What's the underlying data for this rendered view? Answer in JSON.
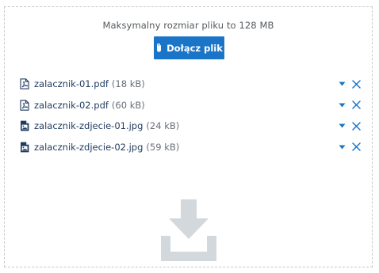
{
  "uploader": {
    "max_size_text": "Maksymalny rozmiar pliku to 128 MB",
    "attach_button_label": "Dołącz plik",
    "drop_icon": "download-tray-icon"
  },
  "files": [
    {
      "name": "zalacznik-01.pdf",
      "size": "(18 kB)",
      "type": "pdf"
    },
    {
      "name": "zalacznik-02.pdf",
      "size": "(60 kB)",
      "type": "pdf"
    },
    {
      "name": "zalacznik-zdjecie-01.jpg",
      "size": "(24 kB)",
      "type": "image"
    },
    {
      "name": "zalacznik-zdjecie-02.jpg",
      "size": "(59 kB)",
      "type": "image"
    }
  ],
  "colors": {
    "accent": "#1a75c8",
    "border": "#c8c8c8",
    "text": "#1f3a5f",
    "icon_muted": "#d2d8dc"
  }
}
